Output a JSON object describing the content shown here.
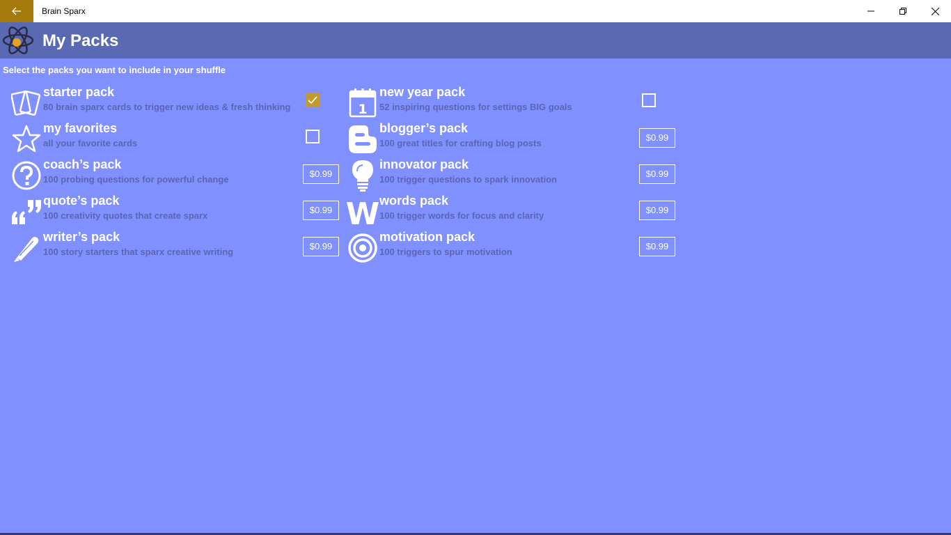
{
  "window": {
    "title": "Brain Sparx"
  },
  "header": {
    "title": "My Packs"
  },
  "instruction": "Select the packs you want to include in your shuffle",
  "colors": {
    "background": "#8090ff",
    "header": "#5a69b3",
    "back_button": "#a47a0c",
    "checked": "#c49a2c",
    "description": "#5b66b0"
  },
  "packs_left": [
    {
      "name": "starter pack",
      "desc": "80 brain sparx cards to trigger new ideas & fresh thinking",
      "icon": "cards-icon",
      "state": "checked"
    },
    {
      "name": "my favorites",
      "desc": "all your favorite cards",
      "icon": "star-icon",
      "state": "unchecked"
    },
    {
      "name": "coach’s pack",
      "desc": "100 probing questions for powerful change",
      "icon": "question-icon",
      "state": "price",
      "price": "$0.99"
    },
    {
      "name": "quote’s pack",
      "desc": "100 creativity quotes that create sparx",
      "icon": "quote-icon",
      "state": "price",
      "price": "$0.99"
    },
    {
      "name": "writer’s pack",
      "desc": "100 story starters that sparx creative writing",
      "icon": "pen-icon",
      "state": "price",
      "price": "$0.99"
    }
  ],
  "packs_right": [
    {
      "name": "new year pack",
      "desc": "52 inspiring questions for settings BIG goals",
      "icon": "calendar-icon",
      "calendar_day": "1",
      "state": "unchecked"
    },
    {
      "name": "blogger’s pack",
      "desc": "100 great titles for crafting blog posts",
      "icon": "blogger-icon",
      "state": "price",
      "price": "$0.99"
    },
    {
      "name": "innovator pack",
      "desc": "100 trigger questions to spark innovation",
      "icon": "lightbulb-icon",
      "state": "price",
      "price": "$0.99"
    },
    {
      "name": "words pack",
      "desc": "100 trigger words for focus and clarity",
      "icon": "w-letter-icon",
      "icon_letter": "W",
      "state": "price",
      "price": "$0.99"
    },
    {
      "name": "motivation pack",
      "desc": "100 triggers to spur motivation",
      "icon": "target-icon",
      "state": "price",
      "price": "$0.99"
    }
  ]
}
